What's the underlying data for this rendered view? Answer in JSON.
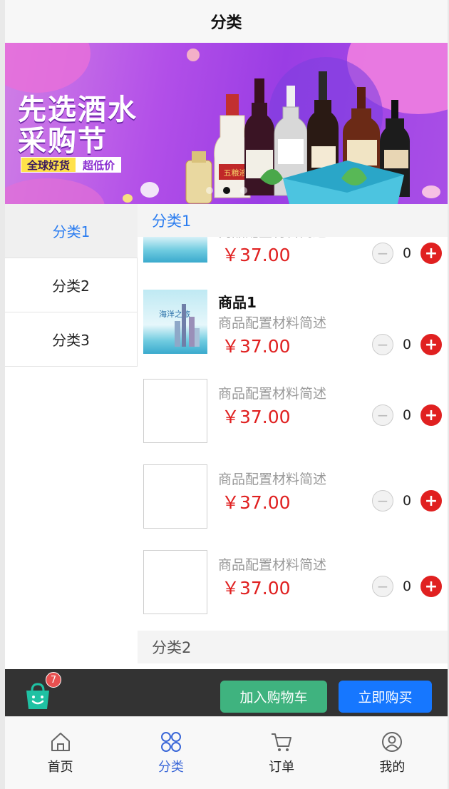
{
  "header": {
    "title": "分类"
  },
  "banner": {
    "headline_line1": "先选酒水",
    "headline_line2": "采购节",
    "tag1": "全球好货",
    "tag2": "超低价",
    "bottle_label": "五粮液"
  },
  "sidebar": {
    "items": [
      {
        "label": "分类1"
      },
      {
        "label": "分类2"
      },
      {
        "label": "分类3"
      }
    ]
  },
  "content": {
    "category1_title": "分类1",
    "category2_title": "分类2",
    "products": [
      {
        "name": "",
        "desc": "商品配置材料简述",
        "price": "￥37.00",
        "qty": "0"
      },
      {
        "name": "商品1",
        "desc": "商品配置材料简述",
        "price": "￥37.00",
        "qty": "0"
      },
      {
        "name": "",
        "desc": "商品配置材料简述",
        "price": "￥37.00",
        "qty": "0"
      },
      {
        "name": "",
        "desc": "商品配置材料简述",
        "price": "￥37.00",
        "qty": "0"
      },
      {
        "name": "",
        "desc": "商品配置材料简述",
        "price": "￥37.00",
        "qty": "0"
      }
    ],
    "thumb_caption": "海洋之旅"
  },
  "stepper": {
    "minus": "−",
    "plus": "+"
  },
  "cart": {
    "badge_count": "7",
    "add_to_cart": "加入购物车",
    "buy_now": "立即购买"
  },
  "tabbar": {
    "items": [
      {
        "label": "首页",
        "icon": "home-icon"
      },
      {
        "label": "分类",
        "icon": "category-icon"
      },
      {
        "label": "订单",
        "icon": "cart-icon"
      },
      {
        "label": "我的",
        "icon": "profile-icon"
      }
    ]
  },
  "colors": {
    "accent": "#2b7df0",
    "price": "#e02020",
    "add_button": "#3fb37f",
    "buy_button": "#1677ff"
  }
}
